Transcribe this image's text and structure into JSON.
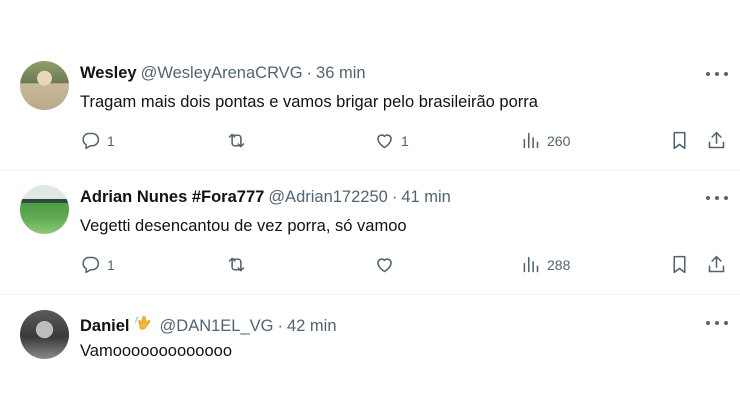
{
  "tweets": [
    {
      "name": "Wesley",
      "handle": "@WesleyArenaCRVG",
      "separator": "·",
      "time": "36 min",
      "text": "Tragam mais dois pontas e vamos brigar pelo brasileirão porra",
      "replies": "1",
      "retweets": "",
      "likes": "1",
      "views": "260",
      "avatar_colors": [
        "#6b7a52",
        "#c9b99a"
      ]
    },
    {
      "name": "Adrian Nunes #Fora777",
      "handle": "@Adrian172250",
      "separator": "·",
      "time": "41 min",
      "text": "Vegetti desencantou de vez porra, só vamoo",
      "replies": "1",
      "retweets": "",
      "likes": "",
      "views": "288",
      "avatar_colors": [
        "#3f8a3a",
        "#9fc98a"
      ]
    },
    {
      "name": "Daniel",
      "handle": "@DAN1EL_VG",
      "separator": "·",
      "time": "42 min",
      "text": "Vamooooooooooooo",
      "avatar_colors": [
        "#4a4a4a",
        "#9a9a9a"
      ]
    }
  ],
  "icons": {
    "more": "more-horizontal-icon",
    "reply": "reply-bubble-icon",
    "retweet": "retweet-arrows-icon",
    "like": "heart-icon",
    "views": "views-bar-chart-icon",
    "bookmark": "bookmark-icon",
    "share": "share-upload-icon",
    "emoji": "waving-hand-emoji"
  },
  "colors": {
    "text_primary": "#0f1419",
    "text_secondary": "#536471",
    "divider": "#eff3f4",
    "emoji": "#f5b82e"
  }
}
